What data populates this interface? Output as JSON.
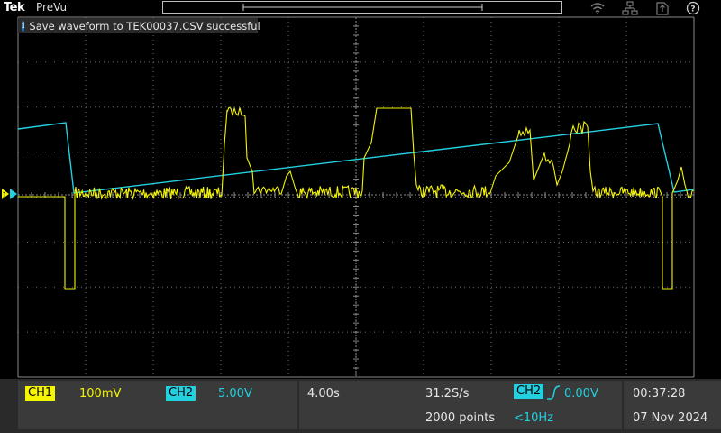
{
  "header": {
    "brand": "Tek",
    "mode": "PreVu"
  },
  "notification": {
    "icon": "info-icon",
    "message": "Save waveform to TEK00037.CSV successful"
  },
  "channels": [
    {
      "name": "CH1",
      "scale": "100mV",
      "color": "#f5f500"
    },
    {
      "name": "CH2",
      "scale": "5.00V",
      "color": "#23d0e0"
    }
  ],
  "horizontal": {
    "time_per_div": "4.00s",
    "sample_rate": "31.2S/s",
    "record_length": "2000 points"
  },
  "trigger": {
    "source": "CH2",
    "slope_icon": "rising-edge-icon",
    "level": "0.00V",
    "frequency": "<10Hz"
  },
  "clock": {
    "time": "00:37:28",
    "date": "07 Nov 2024"
  },
  "status_icons": [
    "wifi-icon",
    "network-icon",
    "usb-icon",
    "help-icon"
  ],
  "colors": {
    "ch1": "#f5f500",
    "ch2": "#23d0e0",
    "grid": "#8a8a8a",
    "panel": "#3a3a3a",
    "notice": "#2b2b2b"
  }
}
